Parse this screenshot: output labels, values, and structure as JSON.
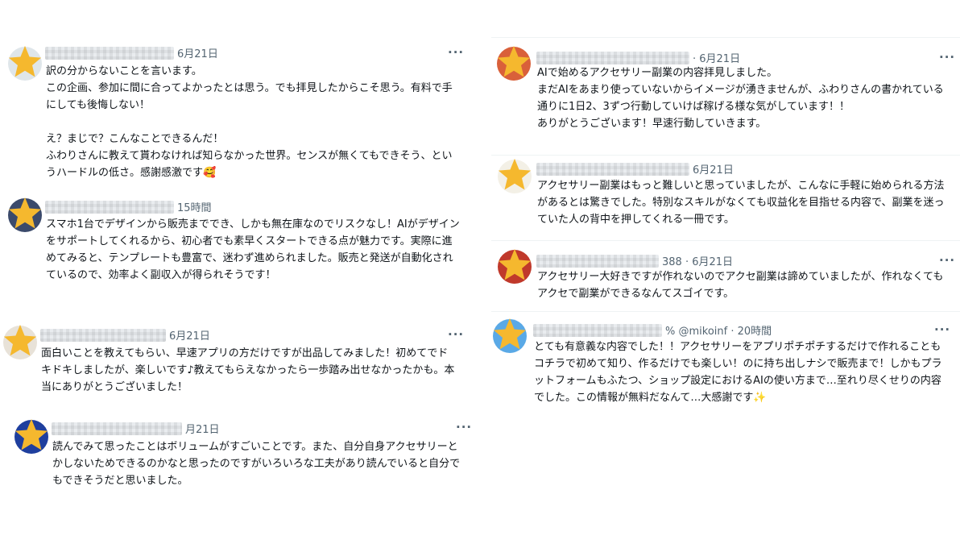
{
  "left": [
    {
      "meta": "6月21日",
      "text": "訳の分からないことを言います。\nこの企画、参加に間に合ってよかったとは思う。でも拝見したからこそ思う。有料で手にしても後悔しない！\n\nえ？まじで？こんなことできるんだ！\nふわりさんに教えて貰わなければ知らなかった世界。センスが無くてもできそう、というハードルの低さ。感謝感激です🥰",
      "avatar_color": "#dfe6ea"
    },
    {
      "meta": "15時間",
      "text": "スマホ1台でデザインから販売まででき、しかも無在庫なのでリスクなし！AIがデザインをサポートしてくれるから、初心者でも素早くスタートできる点が魅力です。実際に進めてみると、テンプレートも豊富で、迷わず進められました。販売と発送が自動化されているので、効率よく副収入が得られそうです！",
      "avatar_color": "#3b4a6b"
    },
    {
      "meta": "6月21日",
      "text": "面白いことを教えてもらい、早速アプリの方だけですが出品してみました！初めてでドキドキしましたが、楽しいです♪教えてもらえなかったら一歩踏み出せなかったかも。本当にありがとうございました！",
      "avatar_color": "#e8e2d8"
    },
    {
      "meta": "月21日",
      "text": "読んでみて思ったことはボリュームがすごいことです。また、自分自身アクセサリーとかしないためできるのかなと思ったのですがいろいろな工夫があり読んでいると自分でもできそうだと思いました。",
      "avatar_color": "#1f3f9e"
    }
  ],
  "right": [
    {
      "meta": "· 6月21日",
      "text": "AIで始めるアクセサリー副業の内容拝見しました。\nまだAIをあまり使っていないからイメージが湧きませんが、ふわりさんの書かれている通りに1日2、3ずつ行動していけば稼げる様な気がしています！！\nありがとうございます！早速行動していきます。",
      "avatar_color": "#d9603a"
    },
    {
      "meta": "6月21日",
      "text": "アクセサリー副業はもっと難しいと思っていましたが、こんなに手軽に始められる方法があるとは驚きでした。特別なスキルがなくても収益化を目指せる内容で、副業を迷っていた人の背中を押してくれる一冊です。",
      "avatar_color": "#f3f0e6"
    },
    {
      "meta": "388 · 6月21日",
      "text": "アクセサリー大好きですが作れないのでアクセ副業は諦めていましたが、作れなくてもアクセで副業ができるなんてスゴイです。",
      "avatar_color": "#c0392b"
    },
    {
      "meta": "% @mikoinf · 20時間",
      "text": "とても有意義な内容でした！！アクセサリーをアプリポチポチするだけで作れることもコチラで初めて知り、作るだけでも楽しい！のに持ち出しナシで販売まで！しかもプラットフォームもふたつ、ショップ設定におけるAIの使い方まで…至れり尽くせりの内容でした。この情報が無料だなんて…大感謝です✨",
      "avatar_color": "#5aa9e6"
    }
  ],
  "more_label": "···",
  "star_color": "#f5b82e"
}
